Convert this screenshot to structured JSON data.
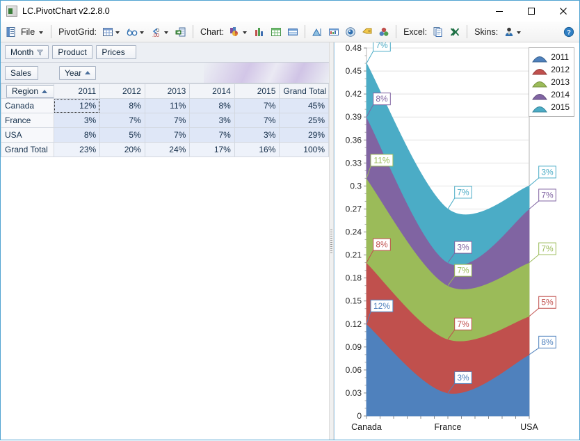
{
  "window": {
    "title": "LC.PivotChart v2.2.8.0",
    "icon": "app-icon",
    "minimize": "–",
    "maximize": "□",
    "close": "✕"
  },
  "toolbar": {
    "file_label": "File",
    "pivotgrid_label": "PivotGrid:",
    "chart_label": "Chart:",
    "excel_label": "Excel:",
    "skins_label": "Skins:",
    "items": [
      {
        "name": "file-menu",
        "icon": "document-menu-icon"
      },
      {
        "name": "pivotgrid-layout",
        "icon": "grid-table-icon"
      },
      {
        "name": "pivotgrid-view",
        "icon": "glasses-icon"
      },
      {
        "name": "pivotgrid-decimals",
        "icon": "decimal-places-icon"
      },
      {
        "name": "pivotgrid-export",
        "icon": "export-arrow-icon"
      },
      {
        "name": "chart-type",
        "icon": "pie-chart-icon"
      },
      {
        "name": "chart-bar",
        "icon": "bar-chart-icon"
      },
      {
        "name": "chart-grid",
        "icon": "green-grid-icon"
      },
      {
        "name": "chart-stripes",
        "icon": "blue-stripes-icon"
      },
      {
        "name": "chart-area",
        "icon": "area-chart-icon"
      },
      {
        "name": "chart-datatable",
        "icon": "data-table-icon"
      },
      {
        "name": "chart-palette",
        "icon": "palette-disc-icon"
      },
      {
        "name": "chart-tag",
        "icon": "yellow-tag-icon"
      },
      {
        "name": "chart-series",
        "icon": "bubbles-icon"
      },
      {
        "name": "excel-copy",
        "icon": "copy-pages-icon"
      },
      {
        "name": "excel-export",
        "icon": "excel-x-icon"
      },
      {
        "name": "skins-dropdown",
        "icon": "person-skin-icon"
      },
      {
        "name": "help",
        "icon": "help-question-icon"
      }
    ]
  },
  "pivot": {
    "filter_fields": [
      {
        "label": "Month",
        "has_filter": true
      },
      {
        "label": "Product",
        "has_filter": false
      },
      {
        "label": "Prices",
        "has_filter": false
      }
    ],
    "data_field": "Sales",
    "column_field": {
      "label": "Year",
      "sort": "asc"
    },
    "row_field": {
      "label": "Region",
      "sort": "asc"
    },
    "columns": [
      "2011",
      "2012",
      "2013",
      "2014",
      "2015",
      "Grand Total"
    ],
    "rows": [
      {
        "header": "Canada",
        "values": [
          "12%",
          "8%",
          "11%",
          "8%",
          "7%",
          "45%"
        ],
        "selected_index": 0
      },
      {
        "header": "France",
        "values": [
          "3%",
          "7%",
          "7%",
          "3%",
          "7%",
          "25%"
        ],
        "selected_index": -1
      },
      {
        "header": "USA",
        "values": [
          "8%",
          "5%",
          "7%",
          "7%",
          "3%",
          "29%"
        ],
        "selected_index": -1
      }
    ],
    "grand_total": {
      "header": "Grand Total",
      "values": [
        "23%",
        "20%",
        "24%",
        "17%",
        "16%",
        "100%"
      ]
    }
  },
  "chart_data": {
    "type": "area",
    "stacked": true,
    "title": "",
    "xlabel": "",
    "ylabel": "",
    "categories": [
      "Canada",
      "France",
      "USA"
    ],
    "series": [
      {
        "name": "2011",
        "color": "#4f81bd",
        "values": [
          0.12,
          0.03,
          0.08
        ],
        "labels": [
          "12%",
          "3%",
          "8%"
        ]
      },
      {
        "name": "2012",
        "color": "#c0504d",
        "values": [
          0.08,
          0.07,
          0.05
        ],
        "labels": [
          "8%",
          "7%",
          "5%"
        ]
      },
      {
        "name": "2013",
        "color": "#9bbb59",
        "values": [
          0.11,
          0.07,
          0.07
        ],
        "labels": [
          "11%",
          "7%",
          "7%"
        ]
      },
      {
        "name": "2014",
        "color": "#8064a2",
        "values": [
          0.08,
          0.03,
          0.07
        ],
        "labels": [
          "8%",
          "3%",
          "7%"
        ]
      },
      {
        "name": "2015",
        "color": "#4bacc6",
        "values": [
          0.07,
          0.07,
          0.03
        ],
        "labels": [
          "7%",
          "7%",
          "3%"
        ]
      }
    ],
    "ylim": [
      0,
      0.48
    ],
    "yticks": [
      "0",
      "0.03",
      "0.06",
      "0.09",
      "0.12",
      "0.15",
      "0.18",
      "0.21",
      "0.24",
      "0.27",
      "0.3",
      "0.33",
      "0.36",
      "0.39",
      "0.42",
      "0.45",
      "0.48"
    ],
    "grid": true,
    "legend_position": "top-right",
    "legend_entries": [
      "2011",
      "2012",
      "2013",
      "2014",
      "2015"
    ]
  }
}
